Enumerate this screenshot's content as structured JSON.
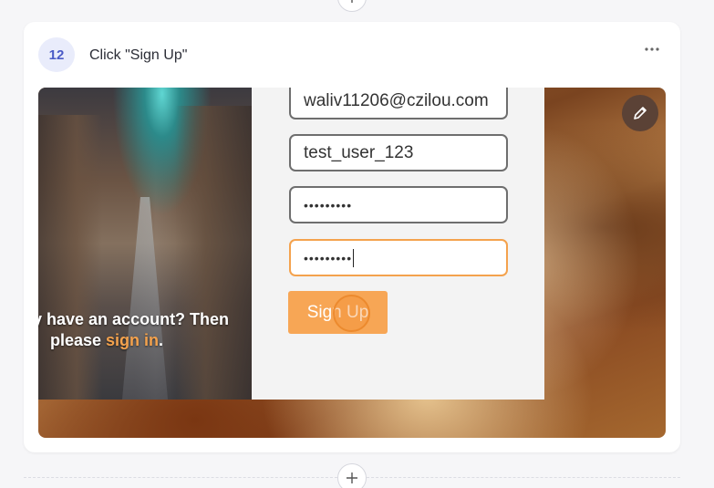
{
  "step": {
    "number": "12",
    "title": "Click \"Sign Up\""
  },
  "screenshot": {
    "city_text_line1": "y have an account? Then",
    "city_text_please": "please ",
    "city_text_link": "sign in",
    "city_text_end": ".",
    "fields": {
      "email": "waliv11206@czilou.com",
      "username": "test_user_123",
      "password": "•••••••••",
      "confirm_password": "•••••••••"
    },
    "signup_label": "Sign Up"
  },
  "icons": {
    "more": "more-horizontal-icon",
    "edit": "pencil-icon",
    "plus": "plus-icon"
  },
  "colors": {
    "accent_orange": "#f7a655",
    "badge_bg": "#e9ecfb",
    "badge_text": "#4b5bc7",
    "edit_button": "#5b4236"
  }
}
